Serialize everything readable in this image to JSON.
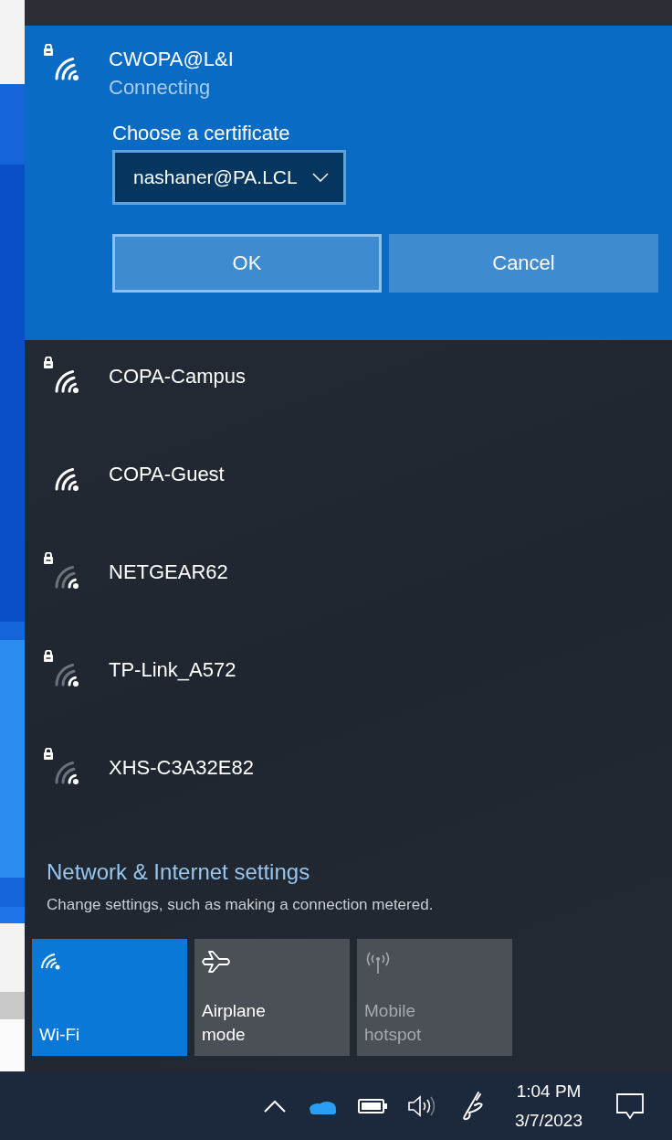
{
  "connecting_network": {
    "name": "CWOPA@L&I",
    "secured": true,
    "weak_signal": false,
    "status": "Connecting",
    "prompt": "Choose a certificate",
    "certificate": {
      "value": "nashaner@PA.LCL"
    },
    "buttons": [
      {
        "label": "OK",
        "focused": true
      },
      {
        "label": "Cancel",
        "focused": false
      }
    ]
  },
  "networks": [
    {
      "name": "COPA-Campus",
      "secured": true,
      "weak_signal": false
    },
    {
      "name": "COPA-Guest",
      "secured": false,
      "weak_signal": false
    },
    {
      "name": "NETGEAR62",
      "secured": true,
      "weak_signal": true
    },
    {
      "name": "TP-Link_A572",
      "secured": true,
      "weak_signal": true
    },
    {
      "name": "XHS-C3A32E82",
      "secured": true,
      "weak_signal": true
    }
  ],
  "settings": {
    "link": "Network & Internet settings",
    "description": "Change settings, such as making a connection metered."
  },
  "quick_actions": [
    {
      "kind": "wifi",
      "label": "Wi-Fi",
      "on": true,
      "disabled": false
    },
    {
      "kind": "airplane",
      "label": "Airplane mode",
      "on": false,
      "disabled": false
    },
    {
      "kind": "hotspot",
      "label": "Mobile hotspot",
      "on": false,
      "disabled": true
    }
  ],
  "taskbar": {
    "time": "1:04 PM",
    "date": "3/7/2023"
  }
}
